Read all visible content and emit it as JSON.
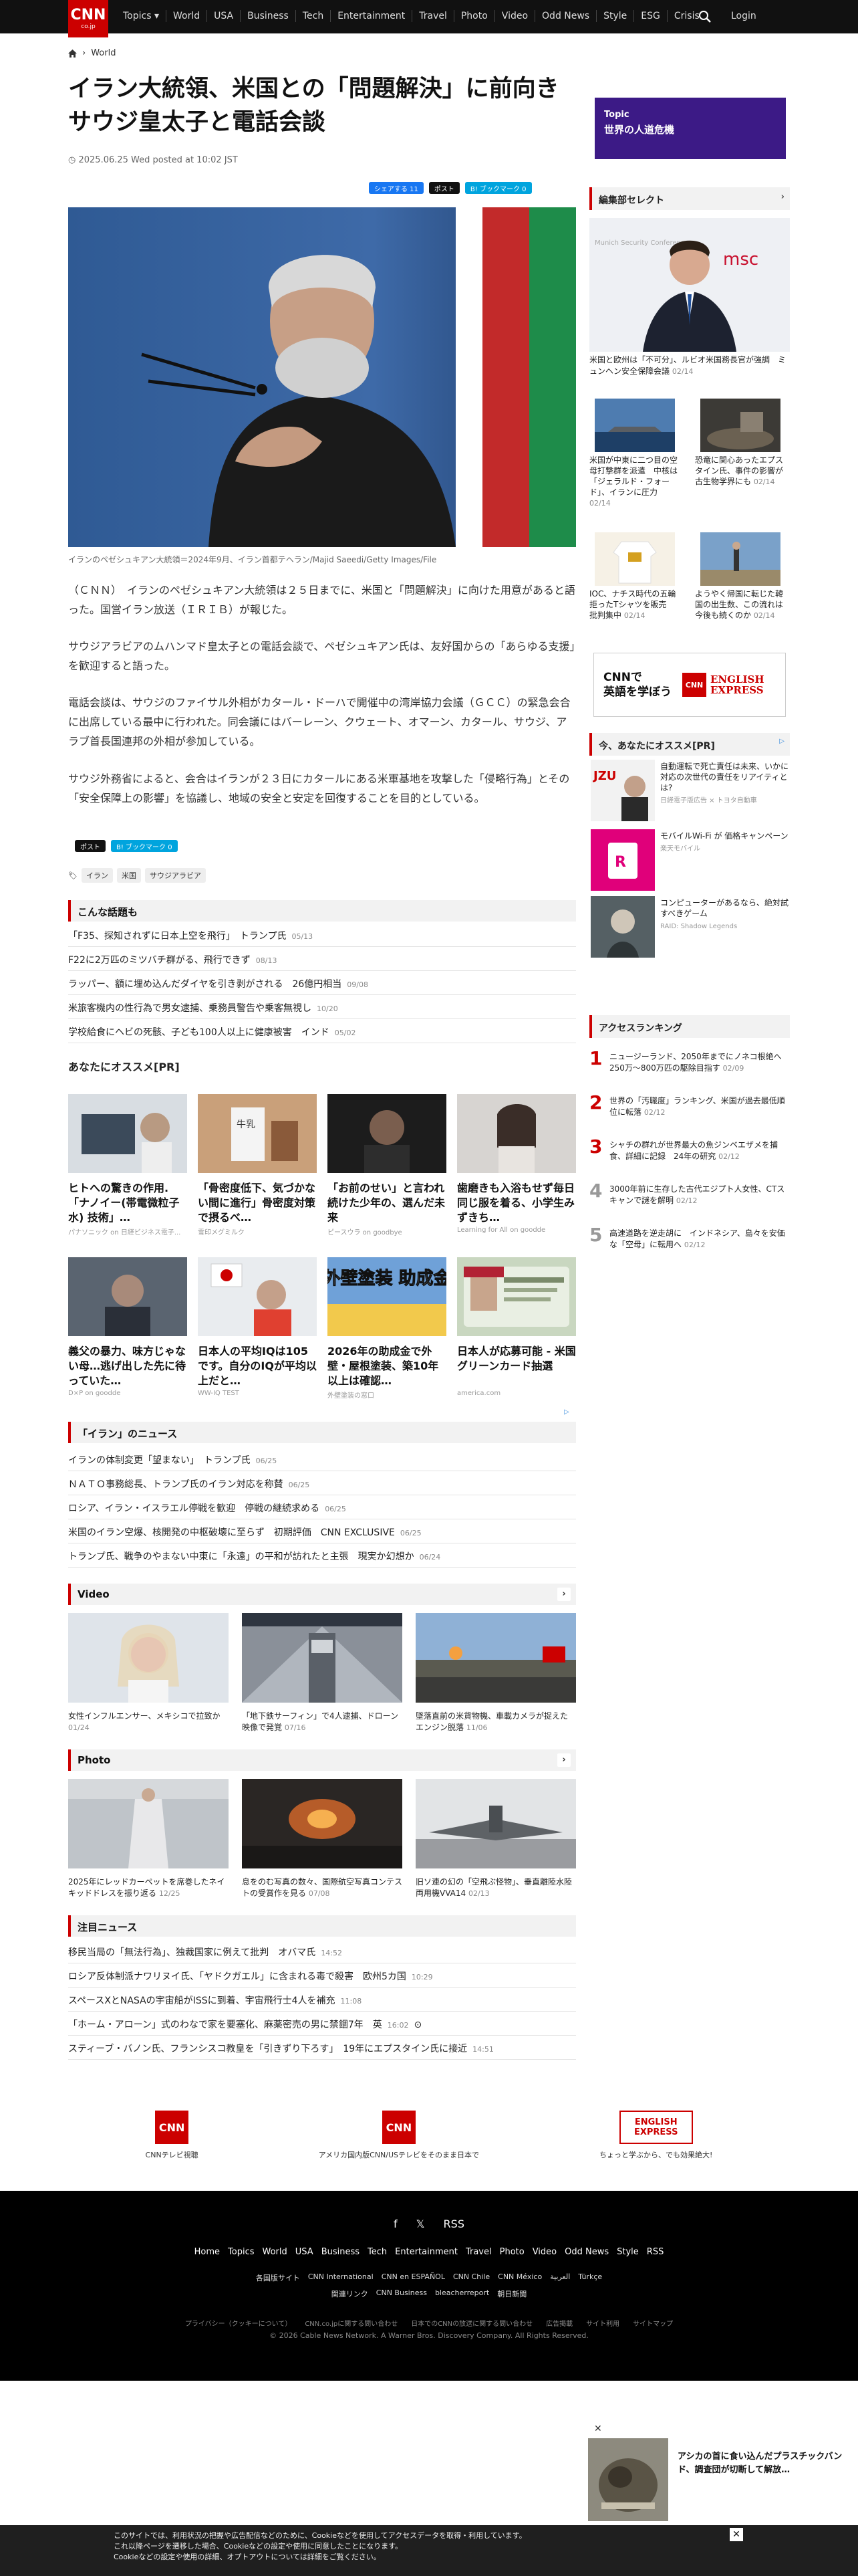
{
  "nav": {
    "logo": "CNN",
    "logo_sub": "co.jp",
    "links": [
      "Topics ▾",
      "World",
      "USA",
      "Business",
      "Tech",
      "Entertainment",
      "Travel",
      "Photo",
      "Video",
      "Odd News",
      "Style",
      "ESG",
      "Crisis"
    ],
    "login": "Login"
  },
  "breadcrumb": {
    "home_icon": "home-icon",
    "current": "World"
  },
  "article": {
    "title": "イラン大統領、米国との「問題解決」に前向き　サウジ皇太子と電話会談",
    "date": "2025.06.25 Wed posted at 10:02 JST",
    "share": {
      "fb": "シェアする 11",
      "x": "ポスト",
      "hb": "B! ブックマーク 0"
    },
    "caption": "イランのペゼシュキアン大統領＝2024年9月、イラン首都テヘラン/Majid Saeedi/Getty Images/File",
    "paragraphs": [
      "（ＣＮＮ）　イランのペゼシュキアン大統領は２５日までに、米国と「問題解決」に向けた用意があると語った。国営イラン放送（ＩＲＩＢ）が報じた。",
      "サウジアラビアのムハンマド皇太子との電話会談で、ペゼシュキアン氏は、友好国からの「あらゆる支援」を歓迎すると語った。",
      "電話会談は、サウジのファイサル外相がカタール・ドーハで開催中の湾岸協力会議（ＧＣＣ）の緊急会合に出席している最中に行われた。同会議にはバーレーン、クウェート、オマーン、カタール、サウジ、アラブ首長国連邦の外相が参加している。",
      "サウジ外務省によると、会合はイランが２３日にカタールにある米軍基地を攻撃した「侵略行為」とその「安全保障上の影響」を協議し、地域の安全と安定を回復することを目的としている。"
    ],
    "tags": [
      "イラン",
      "米国",
      "サウジアラビア"
    ]
  },
  "sections": {
    "related": {
      "title": "こんな話題も",
      "items": [
        {
          "t": "「F35、探知されずに日本上空を飛行」　トランプ氏",
          "d": "05/13"
        },
        {
          "t": "F22に2万匹のミツバチ群がる、飛行できず",
          "d": "08/13"
        },
        {
          "t": "ラッパー、額に埋め込んだダイヤを引き剥がされる　26億円相当",
          "d": "09/08"
        },
        {
          "t": "米旅客機内の性行為で男女逮捕、乗務員警告や乗客無視し",
          "d": "10/20"
        },
        {
          "t": "学校給食にヘビの死骸、子ども100人以上に健康被害　インド",
          "d": "05/02"
        }
      ]
    },
    "pr": {
      "title": "あなたにオススメ[PR]",
      "items": [
        {
          "t": "ヒトへの驚きの作用.「ナノイー(帯電微粒子水) 技術」…",
          "s": "パナソニック on 日経ビジネス電子..."
        },
        {
          "t": "「骨密度低下、気づかない間に進行」骨密度対策で摂るべ…",
          "s": "雪印メグミルク"
        },
        {
          "t": "「お前のせい」と言われ続けた少年の、選んだ未来",
          "s": "ピースウラ on goodbye"
        },
        {
          "t": "歯磨きも入浴もせず毎日同じ服を着る、小学生みずきち…",
          "s": "Learning for All on goodde"
        },
        {
          "t": "義父の暴力、味方じゃない母…逃げ出した先に待っていた…",
          "s": "D×P on goodde"
        },
        {
          "t": "日本人の平均IQは105です。自分のIQが平均以上だと…",
          "s": "WW-IQ TEST"
        },
        {
          "t": "2026年の助成金で外壁・屋根塗装、築10年以上は確認…",
          "s": "外壁塗装の窓口"
        },
        {
          "t": "日本人が応募可能 - 米国グリーンカード抽選",
          "s": "america.com"
        }
      ],
      "img_texts": [
        "牛乳",
        "外壁塗装 助成金"
      ]
    },
    "iran": {
      "title": "「イラン」のニュース",
      "items": [
        {
          "t": "イランの体制変更「望まない」　トランプ氏",
          "d": "06/25"
        },
        {
          "t": "ＮＡＴＯ事務総長、トランプ氏のイラン対応を称賛",
          "d": "06/25"
        },
        {
          "t": "ロシア、イラン・イスラエル停戦を歓迎　停戦の継続求める",
          "d": "06/25"
        },
        {
          "t": "米国のイラン空爆、核開発の中枢破壊に至らず　初期評価　CNN EXCLUSIVE",
          "d": "06/25"
        },
        {
          "t": "トランプ氏、戦争のやまない中東に「永遠」の平和が訪れたと主張　現実か幻想か",
          "d": "06/24"
        }
      ]
    },
    "video": {
      "title": "Video",
      "items": [
        {
          "t": "女性インフルエンサー、メキシコで拉致か",
          "d": "01/24"
        },
        {
          "t": "「地下鉄サーフィン」で4人逮捕、ドローン映像で発覚",
          "d": "07/16"
        },
        {
          "t": "墜落直前の米貨物機、車載カメラが捉えた　エンジン脱落",
          "d": "11/06"
        }
      ]
    },
    "photo": {
      "title": "Photo",
      "items": [
        {
          "t": "2025年にレッドカーペットを席巻したネイキッドドレスを振り返る",
          "d": "12/25"
        },
        {
          "t": "息をのむ写真の数々、国際航空写真コンテストの受賞作を見る",
          "d": "07/08"
        },
        {
          "t": "旧ソ連の幻の「空飛ぶ怪物」、垂直離陸水陸両用機VVA14",
          "d": "02/13"
        }
      ]
    },
    "notable": {
      "title": "注目ニュース",
      "items": [
        {
          "t": "移民当局の「無法行為」、独裁国家に例えて批判　オバマ氏",
          "d": "14:52"
        },
        {
          "t": "ロシア反体制派ナワリヌイ氏、「ヤドクガエル」に含まれる毒で殺害　欧州5カ国",
          "d": "10:29"
        },
        {
          "t": "スペースXとNASAの宇宙船がISSに到着、宇宙飛行士4人を補充",
          "d": "11:08"
        },
        {
          "t": "「ホーム・アローン」式のわなで家を要塞化、麻薬密売の男に禁錮7年　英",
          "d": "16:02"
        },
        {
          "t": "スティーブ・バノン氏、フランシスコ教皇を「引きずり下ろす」　19年にエプスタイン氏に接近",
          "d": "14:51"
        }
      ]
    }
  },
  "sidebar": {
    "topic_label": "Topic",
    "topic_title": "世界の人道危機",
    "editor_title": "編集部セレクト",
    "big_item": {
      "t": "米国と欧州は「不可分」、ルビオ米国務長官が強調　ミュンヘン安全保障会議",
      "d": "02/14"
    },
    "big_img_text": "msc",
    "big_img_text2": "Munich Security Conference",
    "small_items": [
      {
        "t": "米国が中東に二つ目の空母打撃群を派遣　中核は「ジェラルド・フォード」、イランに圧力",
        "d": "02/14"
      },
      {
        "t": "恐竜に関心あったエプスタイン氏、事件の影響が古生物学界にも",
        "d": "02/14"
      },
      {
        "t": "IOC、ナチス時代の五輪拒ったTシャツを販売　批判集中",
        "d": "02/14"
      },
      {
        "t": "ようやく帰国に転じた韓国の出生数、この流れは今後も続くのか",
        "d": "02/14"
      }
    ],
    "english": {
      "line1": "CNNで",
      "line2": "英語を学ぼう",
      "logo1": "ENGLISH",
      "logo2": "EXPRESS"
    },
    "pr_title": "今、あなたにオススメ[PR]",
    "ads": [
      {
        "t": "自動運転で死亡責任は未来、いかに対応の次世代の責任をリアイティとは?",
        "s": "日経電子版広告 × トヨタ自動車"
      },
      {
        "t": "モバイルWi-Fi が 価格キャンペーン",
        "s": "楽天モバイル"
      },
      {
        "t": "コンピューターがあるなら、絶対試すべきゲーム",
        "s": "RAID: Shadow Legends"
      }
    ],
    "ranking_title": "アクセスランキング",
    "ranking": [
      {
        "n": "1",
        "t": "ニュージーランド、2050年までにノネコ根絶へ　250万～800万匹の駆除目指す",
        "d": "02/09"
      },
      {
        "t": "世界の「汚職度」ランキング、米国が過去最低順位に転落",
        "n": "2",
        "d": "02/12"
      },
      {
        "n": "3",
        "t": "シャチの群れが世界最大の魚ジンベエザメを捕食、詳細に記録　24年の研究",
        "d": "02/12"
      },
      {
        "n": "4",
        "t": "3000年前に生存した古代エジプト人女性、CTスキャンで謎を解明",
        "d": "02/12"
      },
      {
        "n": "5",
        "t": "高速道路を逆走胡に　インドネシア、島々を安価な「空母」に転用へ",
        "d": "02/12"
      }
    ]
  },
  "footer": {
    "logos": [
      {
        "label": "CNNテレビ視聴",
        "mark": "CNN"
      },
      {
        "label": "アメリカ国内版CNN/USテレビをそのまま日本で",
        "mark": "CNN"
      },
      {
        "label": "ちょっと学ぶから、でも効果絶大!",
        "mark": "ENGLISH EXPRESS"
      }
    ],
    "social": [
      "f",
      "𝕏",
      "RSS"
    ],
    "nav": [
      "Home",
      "Topics",
      "World",
      "USA",
      "Business",
      "Tech",
      "Entertainment",
      "Travel",
      "Photo",
      "Video",
      "Odd News",
      "Style",
      "RSS"
    ],
    "nav2": [
      "各国版サイト",
      "CNN International",
      "CNN en ESPAÑOL",
      "CNN Chile",
      "CNN México",
      "العربية",
      "Türkçe"
    ],
    "nav3": [
      "関連リンク",
      "CNN Business",
      "bleacherreport",
      "朝日新聞"
    ],
    "nav4": [
      "プライバシー（クッキーについて）",
      "CNN.co.jpに関する問い合わせ",
      "日本でのCNNの放送に関する問い合わせ",
      "広告掲載",
      "サイト利用",
      "サイトマップ"
    ],
    "copyright": "© 2026 Cable News Network. A Warner Bros. Discovery Company. All Rights Reserved."
  },
  "float_ad": {
    "t": "アシカの首に食い込んだプラスチックバンド、調査団が切断して解放…",
    "close": "✕"
  },
  "cookie": {
    "lines": [
      "このサイトでは、利用状況の把握や広告配信などのために、Cookieなどを使用してアクセスデータを取得・利用しています。",
      "これ以降ページを遷移した場合、Cookieなどの設定や使用に同意したことになります。",
      "Cookieなどの設定や使用の詳細、オプトアウトについては詳細をご覧ください。"
    ],
    "close": "✕"
  }
}
